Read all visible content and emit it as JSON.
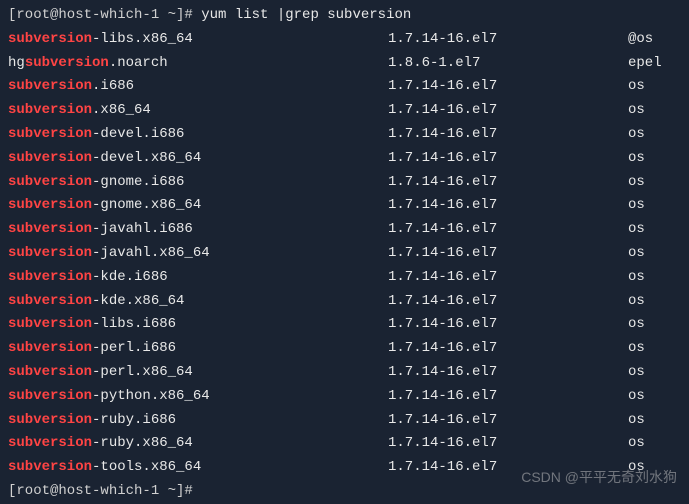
{
  "prompt1": "[root@host-which-1 ~]# ",
  "command": "yum list |grep subversion",
  "prompt2": "[root@host-which-1 ~]# ",
  "watermark": "CSDN @平平无奇刘水狗",
  "rows": [
    {
      "pre": "",
      "hl": "subversion",
      "post": "-libs.x86_64",
      "ver": "1.7.14-16.el7",
      "repo": "@os"
    },
    {
      "pre": "hg",
      "hl": "subversion",
      "post": ".noarch",
      "ver": "1.8.6-1.el7",
      "repo": "epel"
    },
    {
      "pre": "",
      "hl": "subversion",
      "post": ".i686",
      "ver": "1.7.14-16.el7",
      "repo": "os"
    },
    {
      "pre": "",
      "hl": "subversion",
      "post": ".x86_64",
      "ver": "1.7.14-16.el7",
      "repo": "os"
    },
    {
      "pre": "",
      "hl": "subversion",
      "post": "-devel.i686",
      "ver": "1.7.14-16.el7",
      "repo": "os"
    },
    {
      "pre": "",
      "hl": "subversion",
      "post": "-devel.x86_64",
      "ver": "1.7.14-16.el7",
      "repo": "os"
    },
    {
      "pre": "",
      "hl": "subversion",
      "post": "-gnome.i686",
      "ver": "1.7.14-16.el7",
      "repo": "os"
    },
    {
      "pre": "",
      "hl": "subversion",
      "post": "-gnome.x86_64",
      "ver": "1.7.14-16.el7",
      "repo": "os"
    },
    {
      "pre": "",
      "hl": "subversion",
      "post": "-javahl.i686",
      "ver": "1.7.14-16.el7",
      "repo": "os"
    },
    {
      "pre": "",
      "hl": "subversion",
      "post": "-javahl.x86_64",
      "ver": "1.7.14-16.el7",
      "repo": "os"
    },
    {
      "pre": "",
      "hl": "subversion",
      "post": "-kde.i686",
      "ver": "1.7.14-16.el7",
      "repo": "os"
    },
    {
      "pre": "",
      "hl": "subversion",
      "post": "-kde.x86_64",
      "ver": "1.7.14-16.el7",
      "repo": "os"
    },
    {
      "pre": "",
      "hl": "subversion",
      "post": "-libs.i686",
      "ver": "1.7.14-16.el7",
      "repo": "os"
    },
    {
      "pre": "",
      "hl": "subversion",
      "post": "-perl.i686",
      "ver": "1.7.14-16.el7",
      "repo": "os"
    },
    {
      "pre": "",
      "hl": "subversion",
      "post": "-perl.x86_64",
      "ver": "1.7.14-16.el7",
      "repo": "os"
    },
    {
      "pre": "",
      "hl": "subversion",
      "post": "-python.x86_64",
      "ver": "1.7.14-16.el7",
      "repo": "os"
    },
    {
      "pre": "",
      "hl": "subversion",
      "post": "-ruby.i686",
      "ver": "1.7.14-16.el7",
      "repo": "os"
    },
    {
      "pre": "",
      "hl": "subversion",
      "post": "-ruby.x86_64",
      "ver": "1.7.14-16.el7",
      "repo": "os"
    },
    {
      "pre": "",
      "hl": "subversion",
      "post": "-tools.x86_64",
      "ver": "1.7.14-16.el7",
      "repo": "os"
    }
  ]
}
